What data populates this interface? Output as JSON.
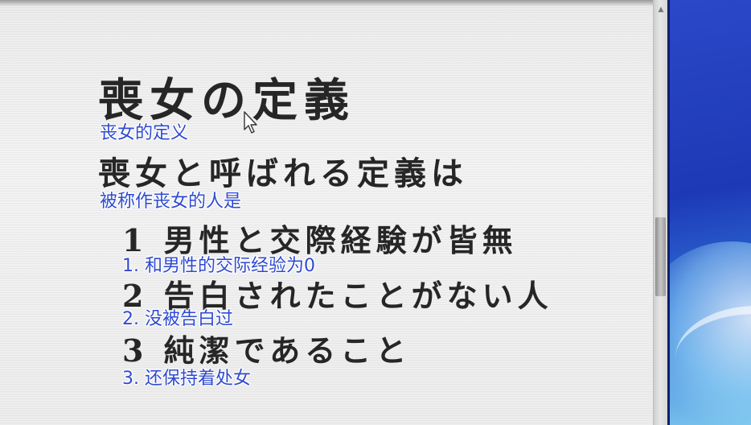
{
  "document": {
    "title": "喪女の定義",
    "subtitle": "喪女と呼ばれる定義は",
    "items": [
      "1 男性と交際経験が皆無",
      "2 告白されたことがない人",
      "3 純潔であること"
    ]
  },
  "subtitles": {
    "title": "丧女的定义",
    "subtitle": "被称作丧女的人是",
    "items": [
      "1. 和男性的交际经验为0",
      "2. 没被告白过",
      "3. 还保持着处女"
    ]
  },
  "icons": {
    "cursor": "mouse-pointer-icon"
  },
  "colors": {
    "subtitle_text": "#2f4ad0",
    "document_text": "#262626",
    "desktop_blue": "#1d39b6"
  }
}
